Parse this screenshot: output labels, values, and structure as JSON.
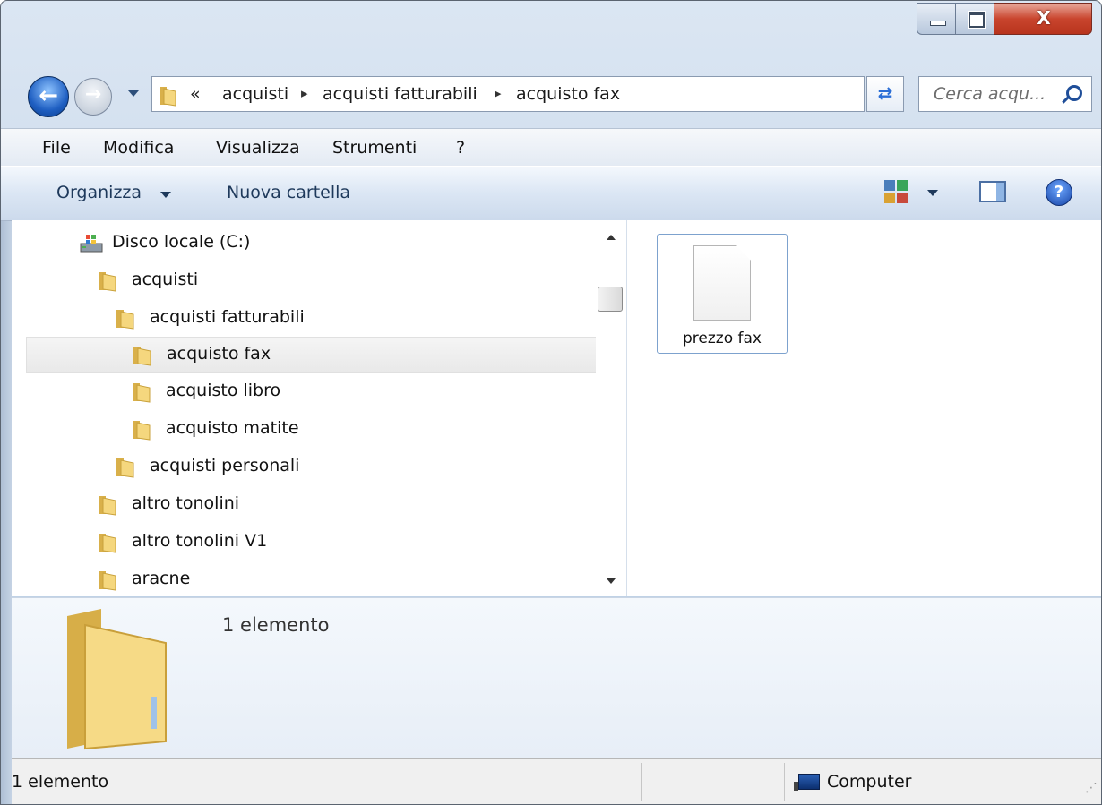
{
  "window": {
    "controls": {
      "minimize_icon": "minimize-icon",
      "maximize_icon": "maximize-icon",
      "close_label": "X"
    }
  },
  "navigation": {
    "back_icon": "back-arrow-icon",
    "forward_icon": "forward-arrow-icon",
    "address": {
      "overflow": "«",
      "crumbs": [
        "acquisti",
        "acquisti fatturabili",
        "acquisto fax"
      ],
      "separator": "▸"
    },
    "refresh_icon": "refresh-icon",
    "search_placeholder": "Cerca acqu...",
    "search_icon": "search-icon"
  },
  "menubar": {
    "items": [
      "File",
      "Modifica",
      "Visualizza",
      "Strumenti",
      "?"
    ]
  },
  "commandbar": {
    "organize_label": "Organizza",
    "new_folder_label": "Nuova cartella",
    "view_icon": "change-view-icon",
    "preview_icon": "preview-pane-icon",
    "help_icon": "help-icon"
  },
  "tree": [
    {
      "label": "Disco locale (C:)",
      "icon": "drive-icon",
      "depth": 0,
      "selected": false
    },
    {
      "label": "acquisti",
      "icon": "folder-icon",
      "depth": 1,
      "selected": false
    },
    {
      "label": "acquisti fatturabili",
      "icon": "folder-icon",
      "depth": 2,
      "selected": false
    },
    {
      "label": "acquisto fax",
      "icon": "folder-icon",
      "depth": 3,
      "selected": true
    },
    {
      "label": "acquisto libro",
      "icon": "folder-icon",
      "depth": 3,
      "selected": false
    },
    {
      "label": "acquisto matite",
      "icon": "folder-icon",
      "depth": 3,
      "selected": false
    },
    {
      "label": "acquisti personali",
      "icon": "folder-icon",
      "depth": 2,
      "selected": false
    },
    {
      "label": "altro tonolini",
      "icon": "folder-icon",
      "depth": 1,
      "selected": false
    },
    {
      "label": "altro tonolini V1",
      "icon": "folder-icon",
      "depth": 1,
      "selected": false
    },
    {
      "label": "aracne",
      "icon": "folder-icon",
      "depth": 1,
      "selected": false
    }
  ],
  "files": [
    {
      "name": "prezzo fax",
      "icon": "document-icon"
    }
  ],
  "details": {
    "item_count": "1 elemento"
  },
  "statusbar": {
    "left": "1 elemento",
    "right": "Computer"
  },
  "colors": {
    "accent": "#1f5fc2",
    "folder": "#e8c35a",
    "selection_border": "#7da2ce"
  }
}
